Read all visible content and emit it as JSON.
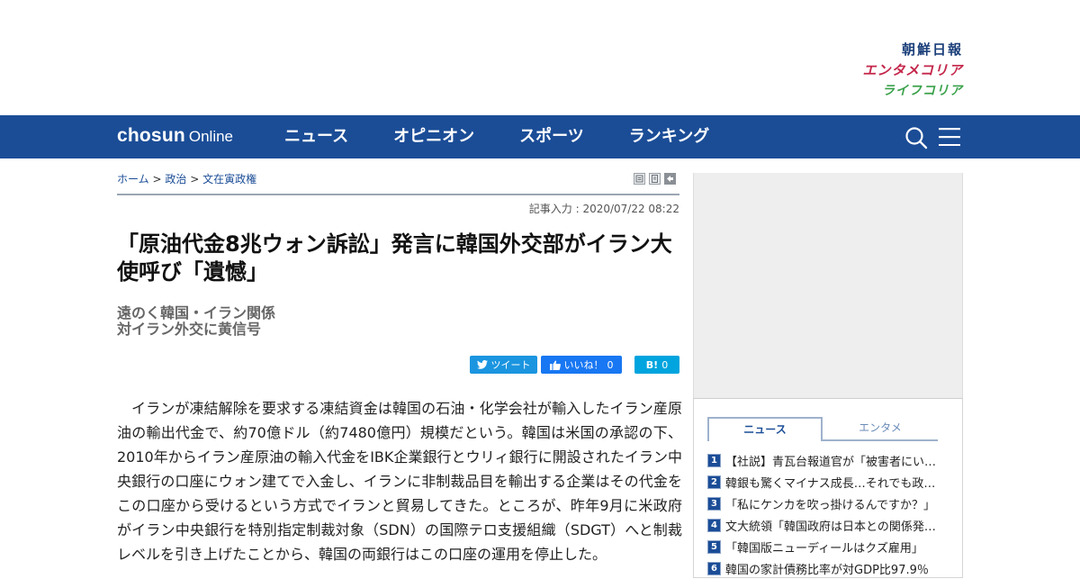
{
  "header": {
    "brand_links": [
      "朝鮮日報",
      "エンタメコリア",
      "ライフコリア"
    ],
    "logo": {
      "main": "chosun",
      "sub": "Online"
    },
    "nav": [
      "ニュース",
      "オピニオン",
      "スポーツ",
      "ランキング"
    ],
    "icons": {
      "search": "search-icon",
      "menu": "hamburger-menu-icon"
    }
  },
  "breadcrumb": {
    "home": "ホーム",
    "sep": ">",
    "level1": "政治",
    "level2": "文在寅政権"
  },
  "article": {
    "timestamp": "記事入力 : 2020/07/22 08:22",
    "headline": "「原油代金8兆ウォン訴訟」発言に韓国外交部がイラン大使呼び「遺憾」",
    "subheads": [
      "遠のく韓国・イラン関係",
      "対イラン外交に黄信号"
    ],
    "body": "イランが凍結解除を要求する凍結資金は韓国の石油・化学会社が輸入したイラン産原油の輸出代金で、約70億ドル（約7480億円）規模だという。韓国は米国の承認の下、2010年からイラン産原油の輸入代金をIBK企業銀行とウリィ銀行に開設されたイラン中央銀行の口座にウォン建てで入金し、イランに非制裁品目を輸出する企業はその代金をこの口座から受けるという方式でイランと貿易してきた。ところが、昨年9月に米政府がイラン中央銀行を特別指定制裁対象（SDN）の国際テロ支援組織（SDGT）へと制裁レベルを引き上げたことから、韓国の両銀行はこの口座の運用を停止した。"
  },
  "share": {
    "twitter_label": "ツイート",
    "like_label": "いいね！",
    "like_count": "0",
    "hatena_label": "B!",
    "hatena_count": "0"
  },
  "sidebar": {
    "tabs": [
      "ニュース",
      "エンタメ"
    ],
    "ranking": [
      {
        "num": "1",
        "title": "【社説】青瓦台報道官が「被害者にいわれのない苦痛」"
      },
      {
        "num": "2",
        "title": "韓銀も驚くマイナス成長…それでも政府は楽観論"
      },
      {
        "num": "3",
        "title": "「私にケンカを吹っ掛けるんですか？」"
      },
      {
        "num": "4",
        "title": "文大統領「韓国政府は日本との関係発展を」"
      },
      {
        "num": "5",
        "title": "「韓国版ニューディールはクズ雇用」"
      },
      {
        "num": "6",
        "title": "韓国の家計債務比率が対GDP比97.9％"
      }
    ]
  },
  "colors": {
    "nav_bg": "#1b4d97",
    "brand_red": "#c4264a",
    "brand_green": "#3aa14a",
    "twitter": "#1b95e0",
    "facebook": "#1877f2",
    "hatena": "#00a4de"
  }
}
